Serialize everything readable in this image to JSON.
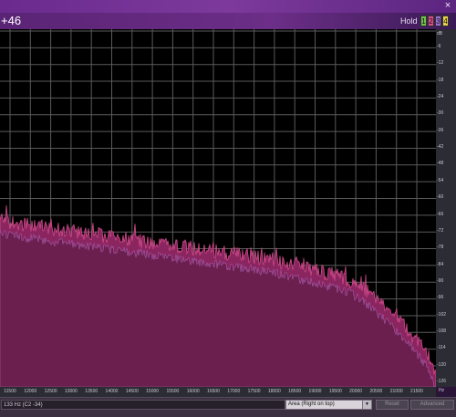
{
  "window": {
    "close_glyph": "×"
  },
  "header": {
    "note_readout": "+46",
    "hold_label": "Hold",
    "hold_buttons": [
      {
        "label": "1",
        "color": "#6fc24a"
      },
      {
        "label": "2",
        "color": "#e04b8c"
      },
      {
        "label": "3",
        "color": "#9b6fd8"
      },
      {
        "label": "4",
        "color": "#e8d24a"
      }
    ]
  },
  "axes": {
    "db_unit": "dB",
    "db_ticks": [
      "-6",
      "-12",
      "-18",
      "-24",
      "-30",
      "-36",
      "-42",
      "-48",
      "-54",
      "-60",
      "-66",
      "-72",
      "-78",
      "-84",
      "-90",
      "-96",
      "-102",
      "-108",
      "-114",
      "-120",
      "-126"
    ],
    "hz_unit": "Hz",
    "hz_ticks": [
      "11500",
      "12000",
      "12500",
      "13000",
      "13500",
      "14000",
      "14500",
      "15000",
      "15500",
      "16000",
      "16500",
      "17000",
      "17500",
      "18000",
      "18500",
      "19000",
      "19500",
      "20000",
      "20500",
      "21000",
      "21500"
    ]
  },
  "status": {
    "readout": "133 Hz (C2 -34)",
    "mode_value": "Area (Right on top)",
    "buttons": [
      "Reset",
      "Advanced"
    ]
  },
  "colors": {
    "plot_bg": "#000000",
    "grid": "#5a5a5a",
    "fill_dark": "#6b1f4e",
    "fill_mid": "#8a2560",
    "fill_edge": "#d04a8a"
  }
}
